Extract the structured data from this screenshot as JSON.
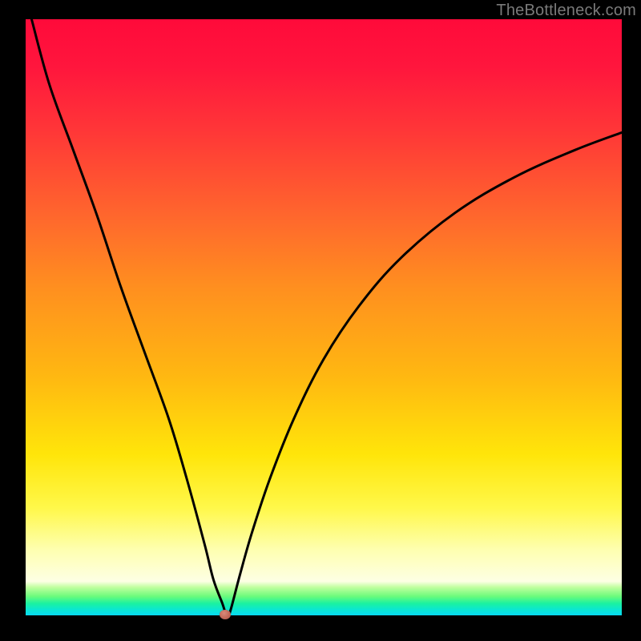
{
  "watermark": {
    "text": "TheBottleneck.com"
  },
  "chart_data": {
    "type": "line",
    "title": "",
    "xlabel": "",
    "ylabel": "",
    "xlim": [
      0,
      100
    ],
    "ylim": [
      0,
      100
    ],
    "grid": false,
    "legend": false,
    "series": [
      {
        "name": "curve",
        "x": [
          1,
          4,
          8,
          12,
          16,
          20,
          24,
          27,
          30,
          31.5,
          33,
          33.5,
          34,
          34.5,
          36,
          38,
          41,
          45,
          50,
          56,
          63,
          72,
          82,
          92,
          100
        ],
        "y": [
          100,
          89,
          78,
          67,
          55,
          44,
          33,
          23,
          12,
          6,
          2,
          0.5,
          0,
          1.3,
          7,
          14,
          23,
          33,
          43,
          52,
          60,
          67.5,
          73.5,
          78,
          81
        ]
      }
    ],
    "marker": {
      "x": 33.5,
      "y": 0
    },
    "background": "gradient_red_orange_yellow_green"
  }
}
